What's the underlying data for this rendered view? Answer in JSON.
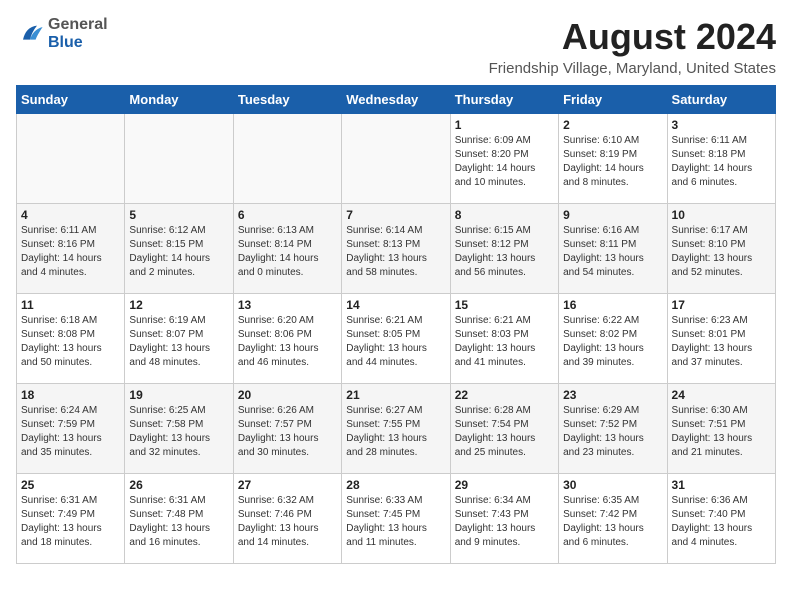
{
  "header": {
    "logo_general": "General",
    "logo_blue": "Blue",
    "month_title": "August 2024",
    "location": "Friendship Village, Maryland, United States"
  },
  "days_of_week": [
    "Sunday",
    "Monday",
    "Tuesday",
    "Wednesday",
    "Thursday",
    "Friday",
    "Saturday"
  ],
  "weeks": [
    [
      {
        "day": "",
        "info": ""
      },
      {
        "day": "",
        "info": ""
      },
      {
        "day": "",
        "info": ""
      },
      {
        "day": "",
        "info": ""
      },
      {
        "day": "1",
        "info": "Sunrise: 6:09 AM\nSunset: 8:20 PM\nDaylight: 14 hours\nand 10 minutes."
      },
      {
        "day": "2",
        "info": "Sunrise: 6:10 AM\nSunset: 8:19 PM\nDaylight: 14 hours\nand 8 minutes."
      },
      {
        "day": "3",
        "info": "Sunrise: 6:11 AM\nSunset: 8:18 PM\nDaylight: 14 hours\nand 6 minutes."
      }
    ],
    [
      {
        "day": "4",
        "info": "Sunrise: 6:11 AM\nSunset: 8:16 PM\nDaylight: 14 hours\nand 4 minutes."
      },
      {
        "day": "5",
        "info": "Sunrise: 6:12 AM\nSunset: 8:15 PM\nDaylight: 14 hours\nand 2 minutes."
      },
      {
        "day": "6",
        "info": "Sunrise: 6:13 AM\nSunset: 8:14 PM\nDaylight: 14 hours\nand 0 minutes."
      },
      {
        "day": "7",
        "info": "Sunrise: 6:14 AM\nSunset: 8:13 PM\nDaylight: 13 hours\nand 58 minutes."
      },
      {
        "day": "8",
        "info": "Sunrise: 6:15 AM\nSunset: 8:12 PM\nDaylight: 13 hours\nand 56 minutes."
      },
      {
        "day": "9",
        "info": "Sunrise: 6:16 AM\nSunset: 8:11 PM\nDaylight: 13 hours\nand 54 minutes."
      },
      {
        "day": "10",
        "info": "Sunrise: 6:17 AM\nSunset: 8:10 PM\nDaylight: 13 hours\nand 52 minutes."
      }
    ],
    [
      {
        "day": "11",
        "info": "Sunrise: 6:18 AM\nSunset: 8:08 PM\nDaylight: 13 hours\nand 50 minutes."
      },
      {
        "day": "12",
        "info": "Sunrise: 6:19 AM\nSunset: 8:07 PM\nDaylight: 13 hours\nand 48 minutes."
      },
      {
        "day": "13",
        "info": "Sunrise: 6:20 AM\nSunset: 8:06 PM\nDaylight: 13 hours\nand 46 minutes."
      },
      {
        "day": "14",
        "info": "Sunrise: 6:21 AM\nSunset: 8:05 PM\nDaylight: 13 hours\nand 44 minutes."
      },
      {
        "day": "15",
        "info": "Sunrise: 6:21 AM\nSunset: 8:03 PM\nDaylight: 13 hours\nand 41 minutes."
      },
      {
        "day": "16",
        "info": "Sunrise: 6:22 AM\nSunset: 8:02 PM\nDaylight: 13 hours\nand 39 minutes."
      },
      {
        "day": "17",
        "info": "Sunrise: 6:23 AM\nSunset: 8:01 PM\nDaylight: 13 hours\nand 37 minutes."
      }
    ],
    [
      {
        "day": "18",
        "info": "Sunrise: 6:24 AM\nSunset: 7:59 PM\nDaylight: 13 hours\nand 35 minutes."
      },
      {
        "day": "19",
        "info": "Sunrise: 6:25 AM\nSunset: 7:58 PM\nDaylight: 13 hours\nand 32 minutes."
      },
      {
        "day": "20",
        "info": "Sunrise: 6:26 AM\nSunset: 7:57 PM\nDaylight: 13 hours\nand 30 minutes."
      },
      {
        "day": "21",
        "info": "Sunrise: 6:27 AM\nSunset: 7:55 PM\nDaylight: 13 hours\nand 28 minutes."
      },
      {
        "day": "22",
        "info": "Sunrise: 6:28 AM\nSunset: 7:54 PM\nDaylight: 13 hours\nand 25 minutes."
      },
      {
        "day": "23",
        "info": "Sunrise: 6:29 AM\nSunset: 7:52 PM\nDaylight: 13 hours\nand 23 minutes."
      },
      {
        "day": "24",
        "info": "Sunrise: 6:30 AM\nSunset: 7:51 PM\nDaylight: 13 hours\nand 21 minutes."
      }
    ],
    [
      {
        "day": "25",
        "info": "Sunrise: 6:31 AM\nSunset: 7:49 PM\nDaylight: 13 hours\nand 18 minutes."
      },
      {
        "day": "26",
        "info": "Sunrise: 6:31 AM\nSunset: 7:48 PM\nDaylight: 13 hours\nand 16 minutes."
      },
      {
        "day": "27",
        "info": "Sunrise: 6:32 AM\nSunset: 7:46 PM\nDaylight: 13 hours\nand 14 minutes."
      },
      {
        "day": "28",
        "info": "Sunrise: 6:33 AM\nSunset: 7:45 PM\nDaylight: 13 hours\nand 11 minutes."
      },
      {
        "day": "29",
        "info": "Sunrise: 6:34 AM\nSunset: 7:43 PM\nDaylight: 13 hours\nand 9 minutes."
      },
      {
        "day": "30",
        "info": "Sunrise: 6:35 AM\nSunset: 7:42 PM\nDaylight: 13 hours\nand 6 minutes."
      },
      {
        "day": "31",
        "info": "Sunrise: 6:36 AM\nSunset: 7:40 PM\nDaylight: 13 hours\nand 4 minutes."
      }
    ]
  ]
}
